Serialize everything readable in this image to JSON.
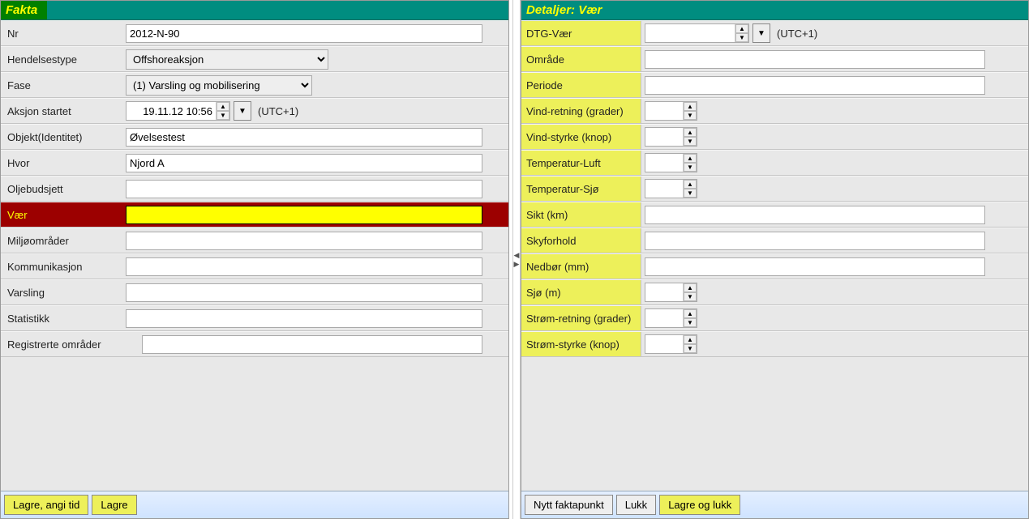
{
  "left": {
    "title": "Fakta",
    "rows": {
      "nr": {
        "label": "Nr",
        "value": "2012-N-90"
      },
      "hendelsestype": {
        "label": "Hendelsestype",
        "value": "Offshoreaksjon"
      },
      "fase": {
        "label": "Fase",
        "value": "(1) Varsling og mobilisering"
      },
      "aksjon_startet": {
        "label": "Aksjon startet",
        "value": "19.11.12 10:56",
        "suffix": "(UTC+1)"
      },
      "objekt": {
        "label": "Objekt(Identitet)",
        "value": "Øvelsestest"
      },
      "hvor": {
        "label": "Hvor",
        "value": "Njord A"
      },
      "oljebudsjett": {
        "label": "Oljebudsjett",
        "value": ""
      },
      "vaer": {
        "label": "Vær",
        "value": ""
      },
      "miljo": {
        "label": "Miljøområder",
        "value": ""
      },
      "komm": {
        "label": "Kommunikasjon",
        "value": ""
      },
      "varsling": {
        "label": "Varsling",
        "value": ""
      },
      "statistikk": {
        "label": "Statistikk",
        "value": ""
      },
      "reg": {
        "label": "Registrerte områder",
        "value": ""
      }
    },
    "buttons": {
      "lagre_angi": "Lagre, angi tid",
      "lagre": "Lagre"
    }
  },
  "right": {
    "title": "Detaljer: Vær",
    "rows": {
      "dtg": {
        "label": "DTG-Vær",
        "value": "",
        "suffix": "(UTC+1)"
      },
      "omrade": {
        "label": "Område",
        "value": ""
      },
      "periode": {
        "label": "Periode",
        "value": ""
      },
      "vind_retning": {
        "label": "Vind-retning (grader)",
        "value": ""
      },
      "vind_styrke": {
        "label": "Vind-styrke (knop)",
        "value": ""
      },
      "temp_luft": {
        "label": "Temperatur-Luft",
        "value": ""
      },
      "temp_sjo": {
        "label": "Temperatur-Sjø",
        "value": ""
      },
      "sikt": {
        "label": "Sikt (km)",
        "value": ""
      },
      "skyforhold": {
        "label": "Skyforhold",
        "value": ""
      },
      "nedbor": {
        "label": "Nedbør (mm)",
        "value": ""
      },
      "sjo": {
        "label": "Sjø (m)",
        "value": ""
      },
      "strom_retning": {
        "label": "Strøm-retning (grader)",
        "value": ""
      },
      "strom_styrke": {
        "label": "Strøm-styrke (knop)",
        "value": ""
      }
    },
    "buttons": {
      "nytt": "Nytt faktapunkt",
      "lukk": "Lukk",
      "lagre_lukk": "Lagre og lukk"
    }
  }
}
